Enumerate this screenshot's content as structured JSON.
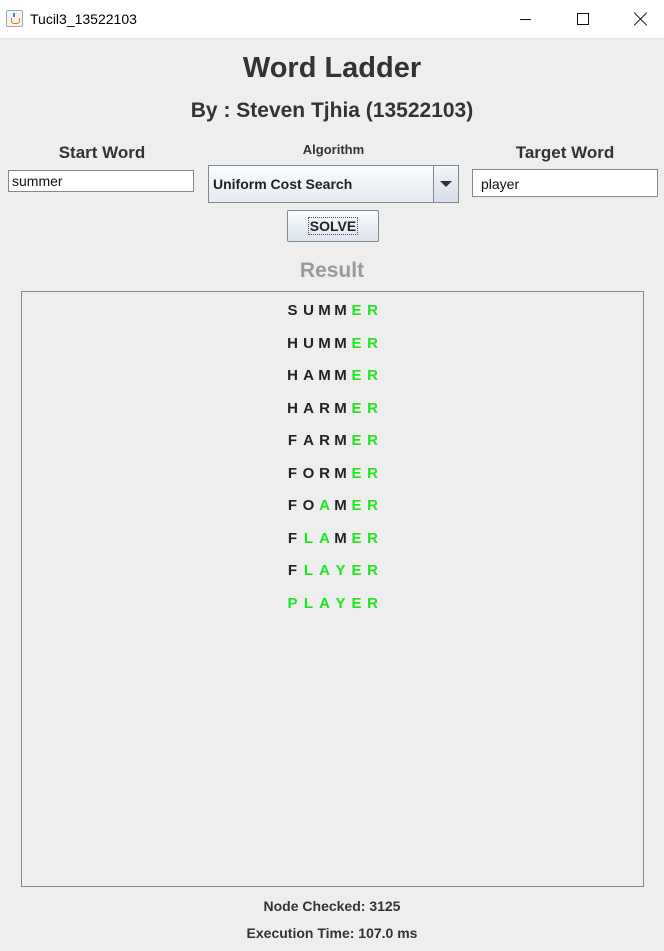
{
  "window": {
    "title": "Tucil3_13522103",
    "icon": "java-icon"
  },
  "header": {
    "title": "Word Ladder",
    "subtitle": "By : Steven Tjhia (13522103)"
  },
  "form": {
    "start_label": "Start Word",
    "start_value": "summer",
    "algorithm_label": "Algorithm",
    "algorithm_value": "Uniform Cost Search",
    "target_label": "Target Word",
    "target_value": "player",
    "solve_label": "SOLVE"
  },
  "result": {
    "title": "Result",
    "target": "PLAYER",
    "words": [
      "SUMMER",
      "HUMMER",
      "HAMMER",
      "HARMER",
      "FARMER",
      "FORMER",
      "FOAMER",
      "FLAMER",
      "FLAYER",
      "PLAYER"
    ]
  },
  "stats": {
    "nodes_checked": "Node Checked: 3125",
    "execution_time": "Execution Time: 107.0 ms"
  },
  "colors": {
    "match_letter": "#1ee61e",
    "other_letter": "#222222",
    "result_title": "#9a9a9a"
  }
}
